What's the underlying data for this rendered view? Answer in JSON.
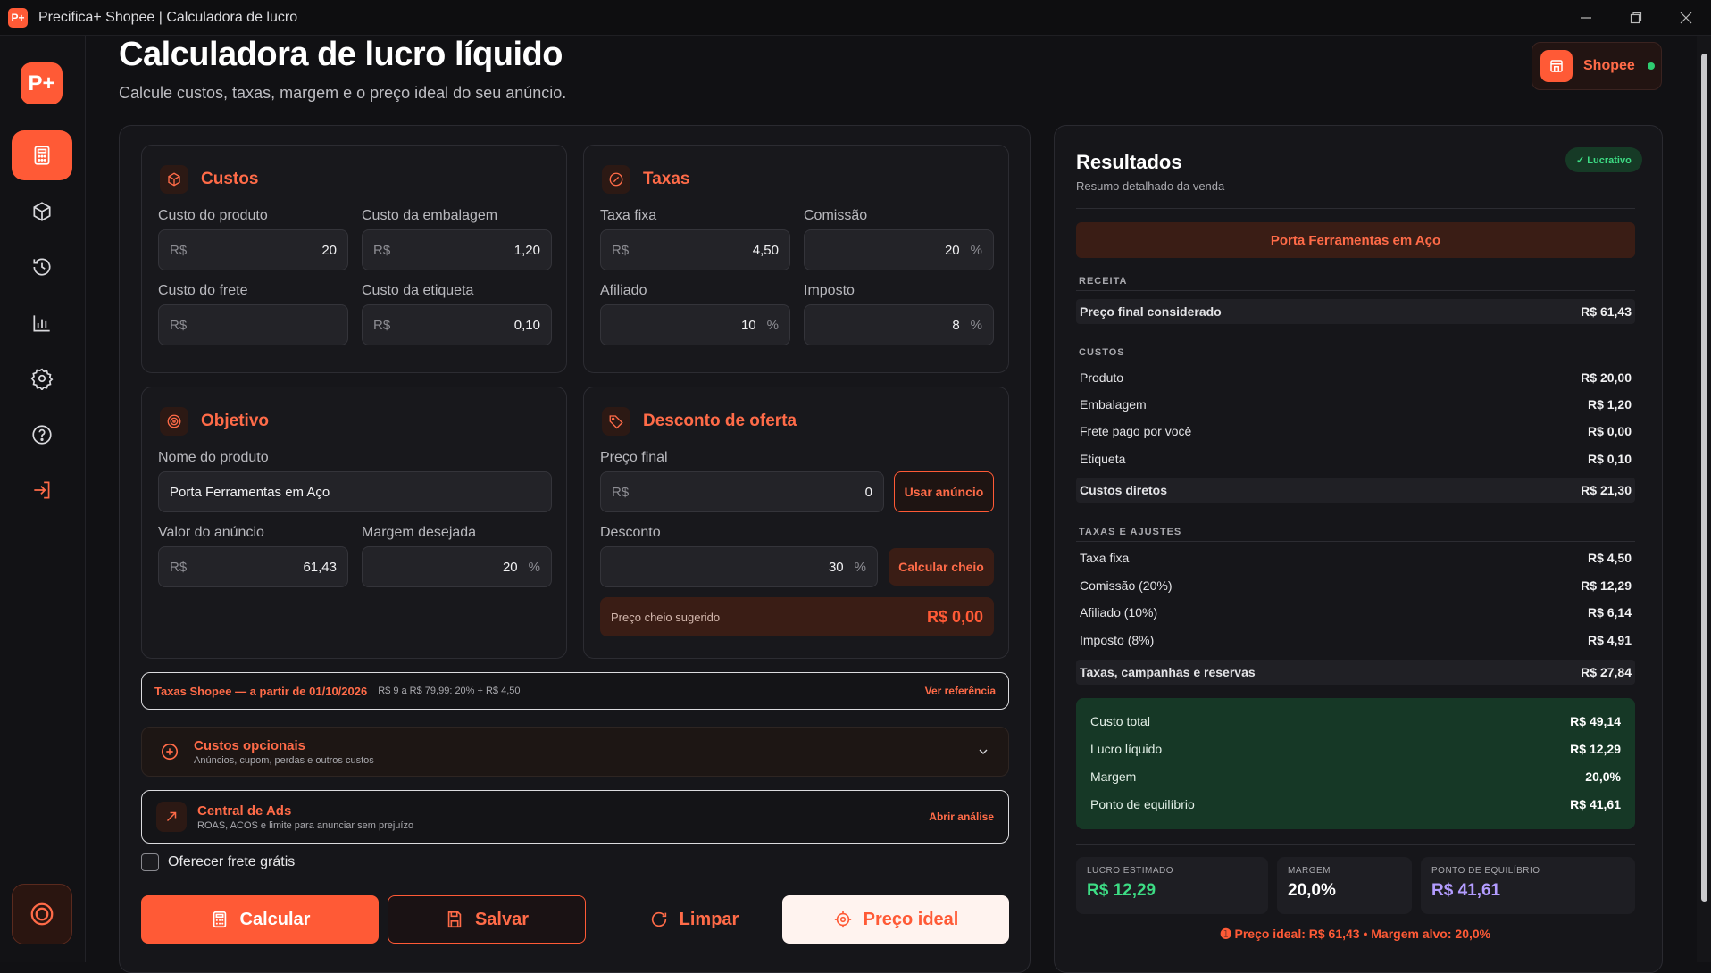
{
  "window": {
    "app_badge": "P+",
    "title": "Precifica+ Shopee | Calculadora de lucro"
  },
  "sidebar": {
    "logo": "P+"
  },
  "header": {
    "title": "Calculadora de lucro líquido",
    "subtitle": "Calcule custos, taxas, margem e o preço ideal do seu anúncio.",
    "platform": "Shopee"
  },
  "custos": {
    "title": "Custos",
    "produto_label": "Custo do produto",
    "produto_prefix": "R$",
    "produto_value": "20",
    "embalagem_label": "Custo da embalagem",
    "embalagem_prefix": "R$",
    "embalagem_value": "1,20",
    "frete_label": "Custo do frete",
    "frete_prefix": "R$",
    "frete_value": "",
    "etiqueta_label": "Custo da etiqueta",
    "etiqueta_prefix": "R$",
    "etiqueta_value": "0,10"
  },
  "taxas": {
    "title": "Taxas",
    "fixa_label": "Taxa fixa",
    "fixa_prefix": "R$",
    "fixa_value": "4,50",
    "comissao_label": "Comissão",
    "comissao_value": "20",
    "comissao_suffix": "%",
    "afiliado_label": "Afiliado",
    "afiliado_value": "10",
    "afiliado_suffix": "%",
    "imposto_label": "Imposto",
    "imposto_value": "8",
    "imposto_suffix": "%"
  },
  "objetivo": {
    "title": "Objetivo",
    "nome_label": "Nome do produto",
    "nome_value": "Porta Ferramentas em Aço",
    "valor_label": "Valor do anúncio",
    "valor_prefix": "R$",
    "valor_value": "61,43",
    "margem_label": "Margem desejada",
    "margem_value": "20",
    "margem_suffix": "%"
  },
  "desconto": {
    "title": "Desconto de oferta",
    "preco_label": "Preço final",
    "preco_prefix": "R$",
    "preco_value": "0",
    "usar_btn": "Usar anúncio",
    "desconto_label": "Desconto",
    "desconto_value": "30",
    "desconto_suffix": "%",
    "calc_btn": "Calcular cheio",
    "sugerido_label": "Preço cheio sugerido",
    "sugerido_value": "R$ 0,00"
  },
  "fees_bar": {
    "title": "Taxas Shopee — a partir de 01/10/2026",
    "detail": "R$ 9 a R$ 79,99: 20% + R$ 4,50",
    "link": "Ver referência"
  },
  "opcionais": {
    "title": "Custos opcionais",
    "subtitle": "Anúncios, cupom, perdas e outros custos"
  },
  "ads": {
    "title": "Central de Ads",
    "subtitle": "ROAS, ACOS e limite para anunciar sem prejuízo",
    "link": "Abrir análise"
  },
  "frete_gratis": {
    "label": "Oferecer frete grátis"
  },
  "actions": {
    "calcular": "Calcular",
    "salvar": "Salvar",
    "limpar": "Limpar",
    "preco_ideal": "Preço ideal"
  },
  "results": {
    "title": "Resultados",
    "subtitle": "Resumo detalhado da venda",
    "status": "✓ Lucrativo",
    "product": "Porta Ferramentas em Aço",
    "receita_h": "RECEITA",
    "receita": {
      "label": "Preço final considerado",
      "value": "R$ 61,43"
    },
    "custos_h": "CUSTOS",
    "custos": [
      {
        "label": "Produto",
        "value": "R$ 20,00"
      },
      {
        "label": "Embalagem",
        "value": "R$ 1,20"
      },
      {
        "label": "Frete pago por você",
        "value": "R$ 0,00"
      },
      {
        "label": "Etiqueta",
        "value": "R$ 0,10"
      }
    ],
    "custos_total": {
      "label": "Custos diretos",
      "value": "R$ 21,30"
    },
    "taxas_h": "TAXAS E AJUSTES",
    "taxas": [
      {
        "label": "Taxa fixa",
        "value": "R$ 4,50"
      },
      {
        "label": "Comissão (20%)",
        "value": "R$ 12,29"
      },
      {
        "label": "Afiliado (10%)",
        "value": "R$ 6,14"
      },
      {
        "label": "Imposto (8%)",
        "value": "R$ 4,91"
      }
    ],
    "taxas_total": {
      "label": "Taxas, campanhas e reservas",
      "value": "R$ 27,84"
    },
    "summary": [
      {
        "label": "Custo total",
        "value": "R$ 49,14"
      },
      {
        "label": "Lucro líquido",
        "value": "R$ 12,29"
      },
      {
        "label": "Margem",
        "value": "20,0%"
      },
      {
        "label": "Ponto de equilíbrio",
        "value": "R$ 41,61"
      }
    ],
    "kpis": [
      {
        "label": "LUCRO ESTIMADO",
        "value": "R$ 12,29",
        "color": "#3ddc84"
      },
      {
        "label": "MARGEM",
        "value": "20,0%",
        "color": "#ffffff"
      },
      {
        "label": "PONTO DE EQUILÍBRIO",
        "value": "R$ 41,61",
        "color": "#b39cff"
      }
    ],
    "footer": "➊ Preço ideal: R$ 61,43 • Margem alvo: 20,0%"
  },
  "colors": {
    "accent": "#ff5a36",
    "profit": "#3ddc84",
    "break_even": "#b39cff"
  }
}
